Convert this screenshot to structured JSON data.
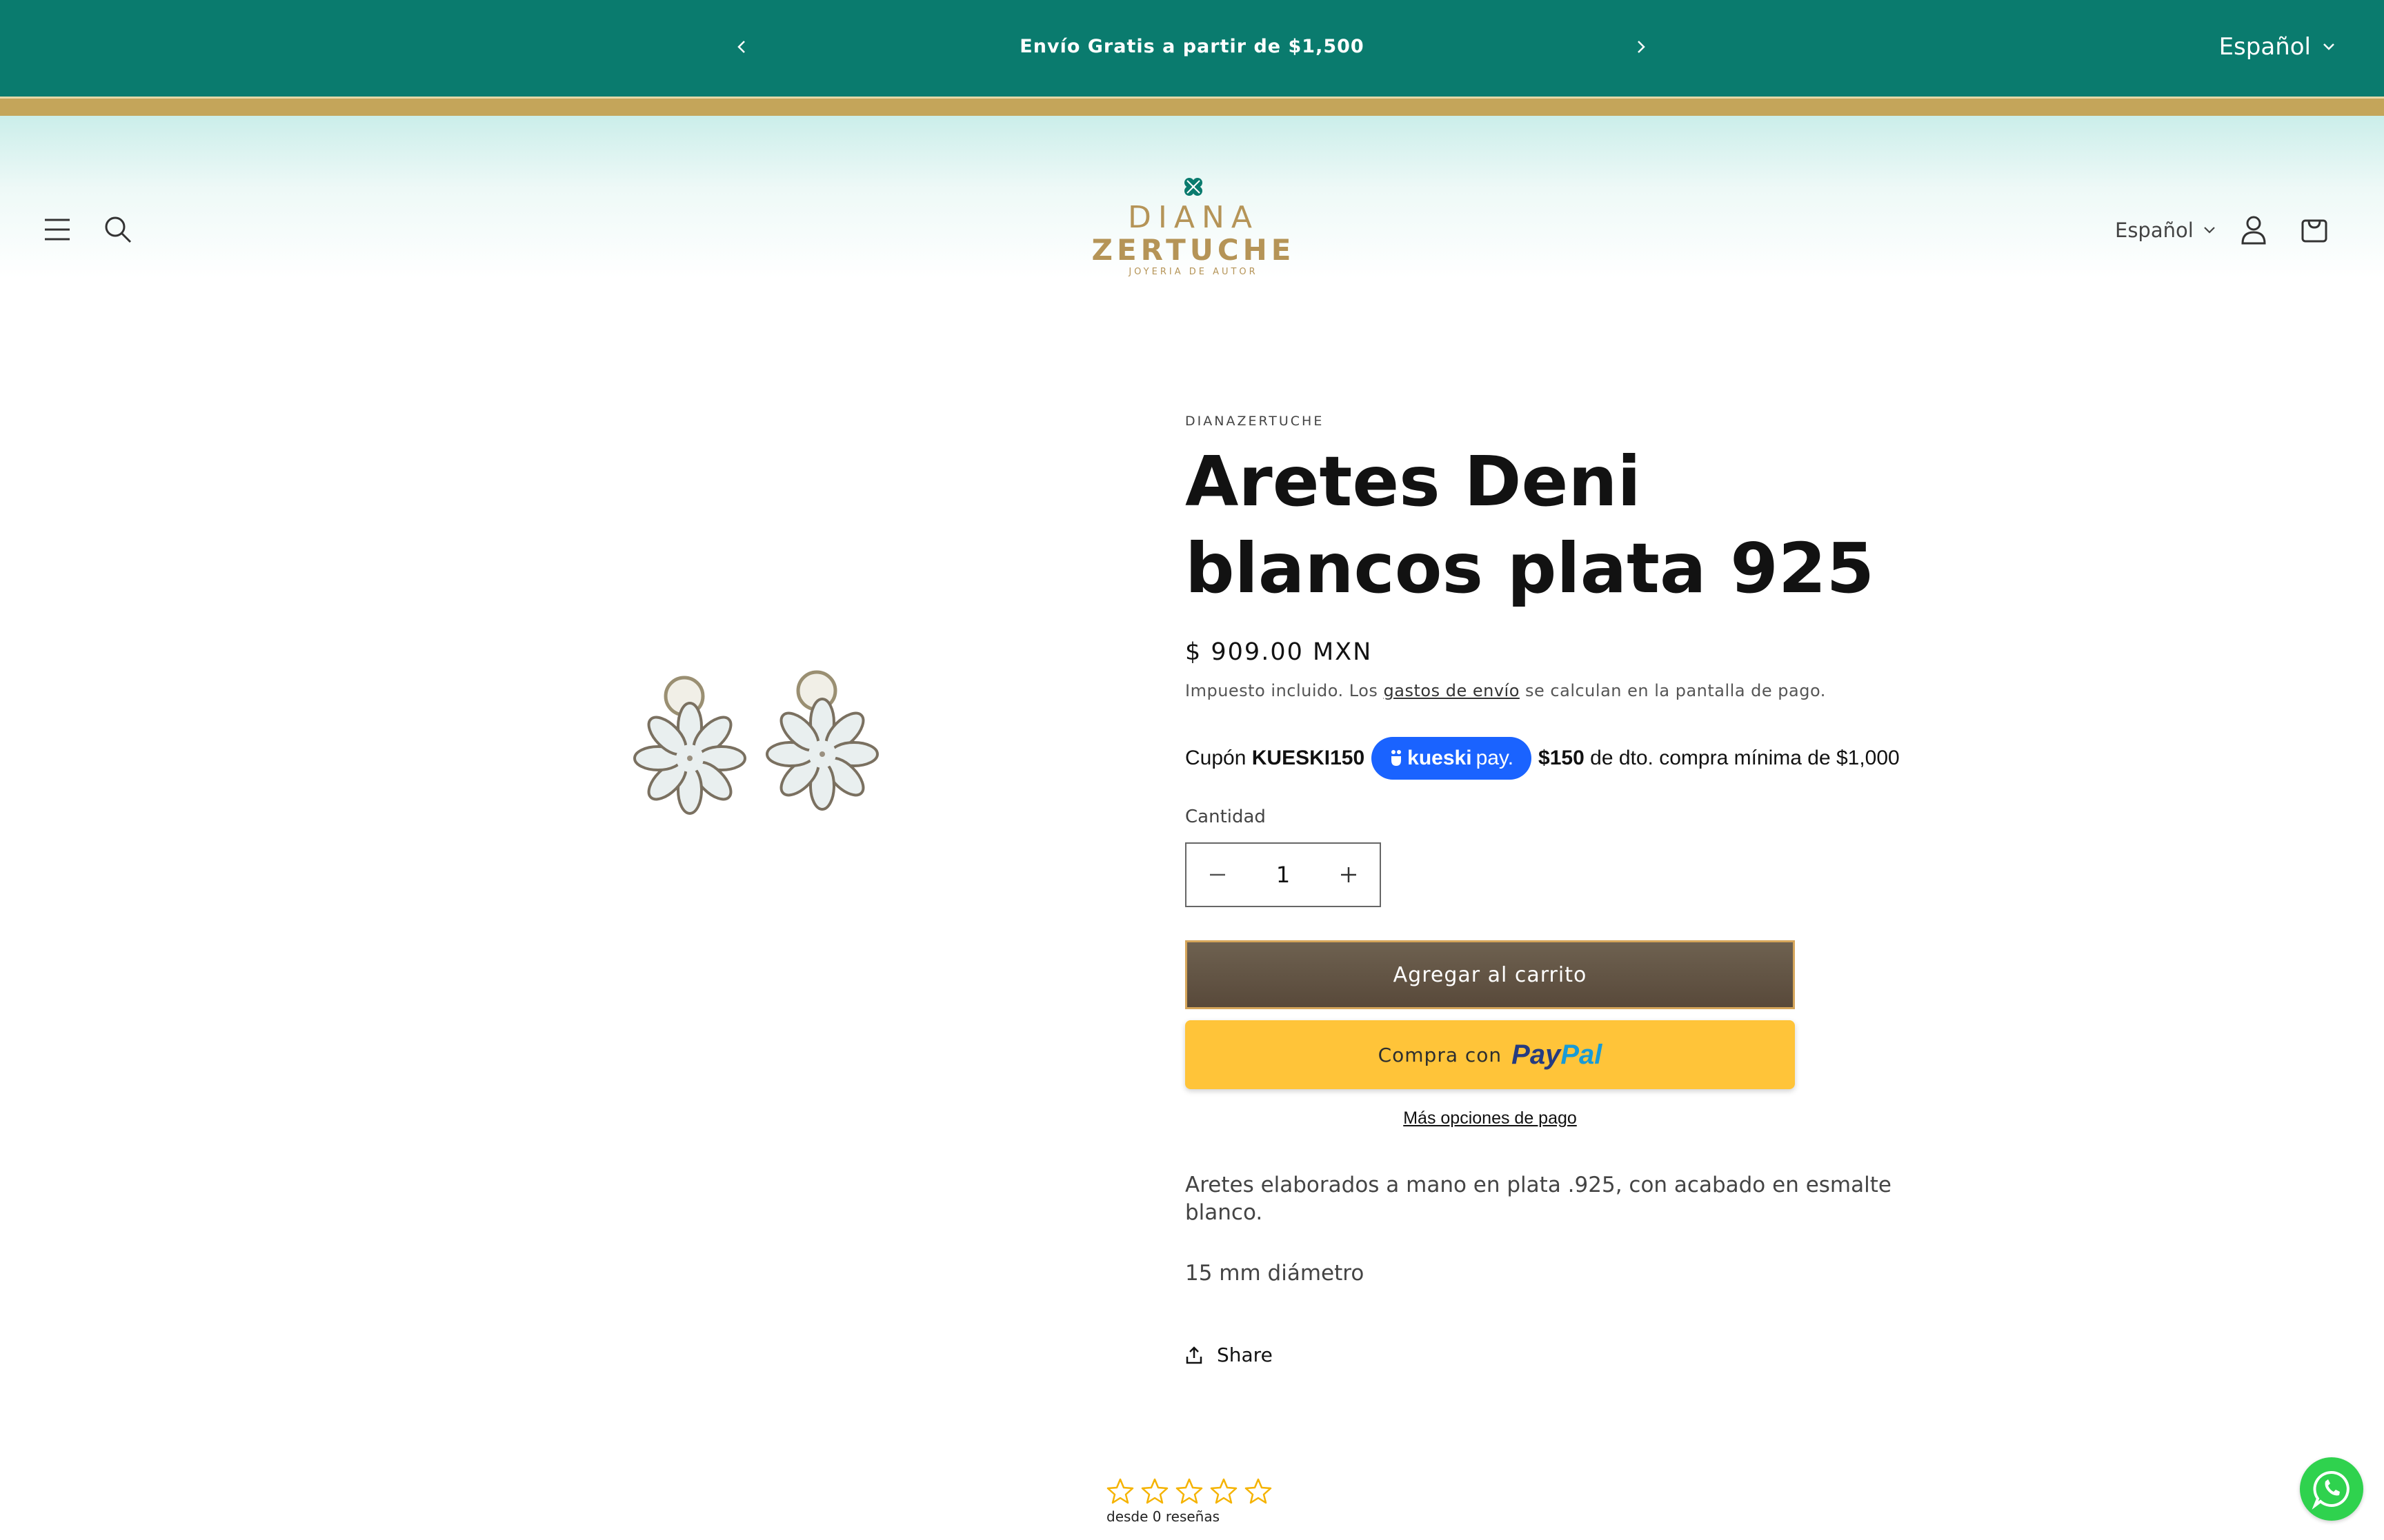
{
  "announcement": {
    "message": "Envío Gratis a partir de $1,500",
    "language": "Español"
  },
  "header": {
    "logo": {
      "line1": "DIANA",
      "line2": "ZERTUCHE",
      "line3": "JOYERIA DE AUTOR"
    },
    "language": "Español"
  },
  "product": {
    "vendor": "DIANAZERTUCHE",
    "title": "Aretes Deni blancos plata 925",
    "price": "$ 909.00 MXN",
    "tax_before": "Impuesto incluido. Los ",
    "tax_link": "gastos de envío",
    "tax_after": " se calculan en la pantalla de pago.",
    "coupon": {
      "prefix": "Cupón",
      "code": "KUESKI150",
      "badge_bold": "kueski",
      "badge_rest": "pay.",
      "amount": "$150",
      "suffix": "de dto. compra mínima de $1,000"
    },
    "quantity_label": "Cantidad",
    "quantity": "1",
    "add_to_cart": "Agregar al carrito",
    "paypal_prefix": "Compra con",
    "paypal_logo_1": "Pay",
    "paypal_logo_2": "Pal",
    "more_options": "Más opciones de pago",
    "description": [
      "Aretes elaborados a mano en plata .925, con acabado en esmalte blanco.",
      "15 mm diámetro"
    ],
    "share": "Share"
  },
  "reviews": {
    "rating": 0,
    "max": 5,
    "count_text": "desde 0 reseñas"
  },
  "colors": {
    "brand_teal": "#0a7b6e",
    "gold": "#b59457",
    "cart_button": "#5e5041",
    "paypal_yellow": "#ffc439",
    "kueski_blue": "#1a63ff",
    "star": "#f5b301",
    "whatsapp": "#2fd24e"
  },
  "icons": {
    "menu": "menu-icon",
    "search": "search-icon",
    "account": "account-icon",
    "cart": "cart-icon",
    "share": "share-icon",
    "whatsapp": "whatsapp-icon"
  }
}
